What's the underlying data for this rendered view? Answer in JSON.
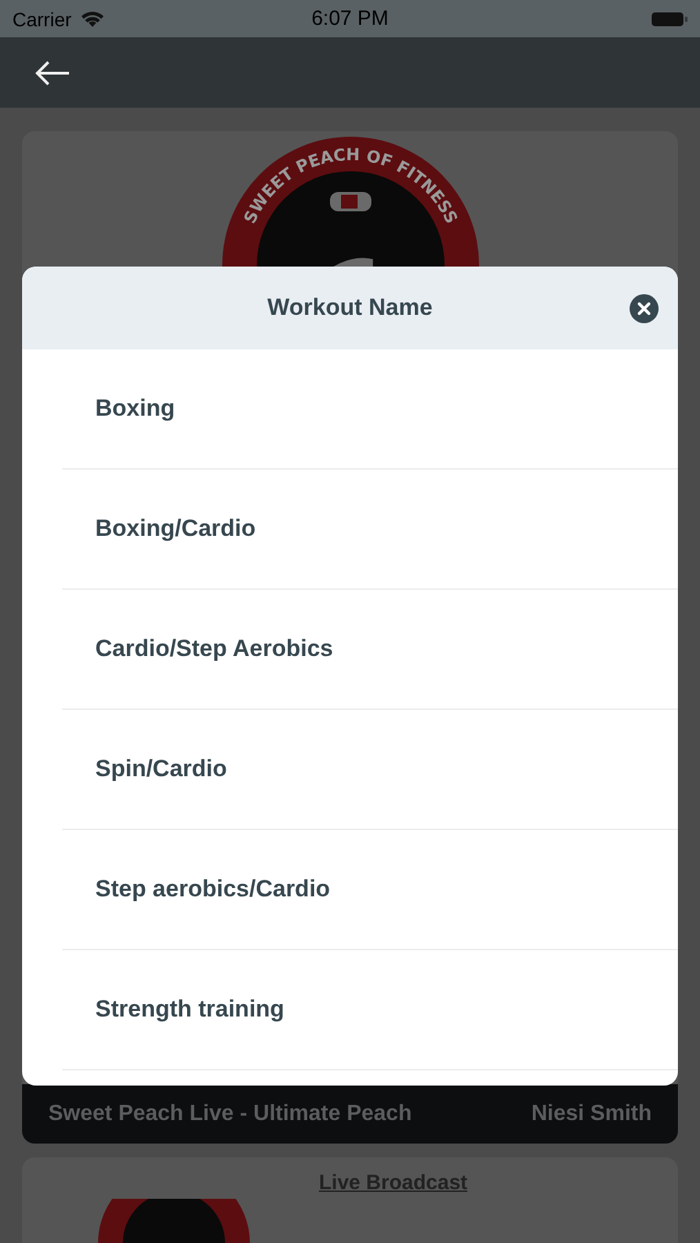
{
  "status_bar": {
    "carrier": "Carrier",
    "time": "6:07 PM"
  },
  "featured_card": {
    "logo_text": "SWEET PEACH OF FITNESS",
    "live_bar": {
      "title": "Sweet Peach Live - Ultimate Peach",
      "trainer": "Niesi Smith"
    }
  },
  "next_card": {
    "link": "Live Broadcast"
  },
  "modal": {
    "title": "Workout Name",
    "options": [
      {
        "label": "Boxing"
      },
      {
        "label": "Boxing/Cardio"
      },
      {
        "label": "Cardio/Step Aerobics"
      },
      {
        "label": "Spin/Cardio"
      },
      {
        "label": "Step aerobics/Cardio"
      },
      {
        "label": "Strength training"
      }
    ]
  }
}
